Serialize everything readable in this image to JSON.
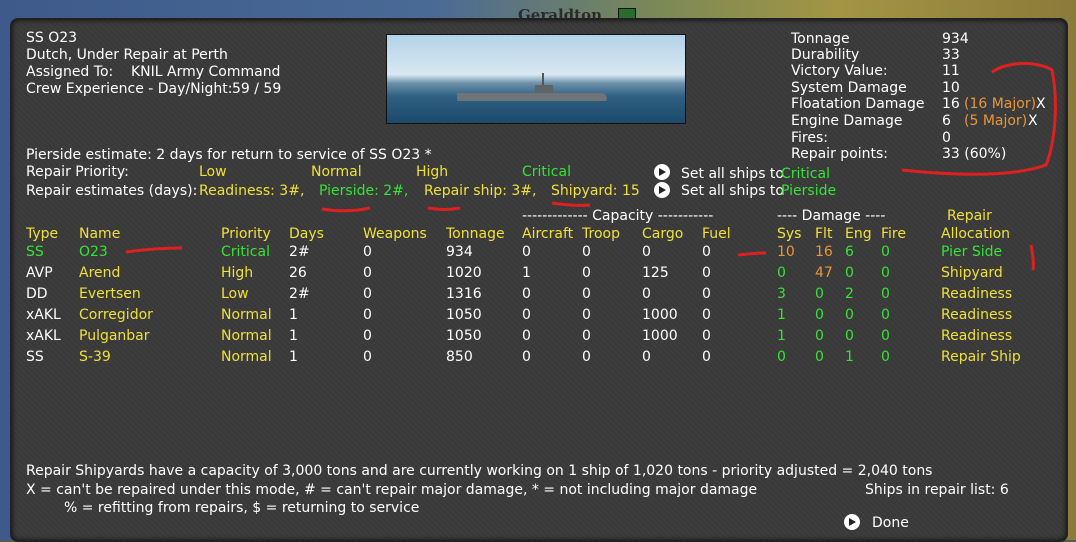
{
  "map": {
    "label": "Geraldton"
  },
  "ship": {
    "title": "SS O23",
    "status": "Dutch, Under Repair at Perth",
    "assigned_label": "Assigned To:",
    "assigned_value": "KNIL Army Command",
    "crew_label": "Crew Experience - Day/Night:",
    "crew_value": "59  /  59"
  },
  "stats": {
    "tonnage_label": "Tonnage",
    "tonnage": "934",
    "durability_label": "Durability",
    "durability": "33",
    "victory_label": "Victory Value:",
    "victory": "11",
    "system_label": "System Damage",
    "system": "10",
    "floatation_label": "Floatation Damage",
    "floatation": "16",
    "floatation_major": "(16 Major)",
    "engine_label": "Engine Damage",
    "engine": "6",
    "engine_major": "(5 Major)",
    "fires_label": "Fires:",
    "fires": "0",
    "repair_points_label": "Repair points:",
    "repair_points": "33 (60%)",
    "x_mark": "X"
  },
  "estimate": {
    "pierside_text": "Pierside estimate: 2 days for return to service of SS O23 *",
    "priority_label": "Repair Priority:",
    "priorities": [
      "Low",
      "Normal",
      "High",
      "Critical"
    ],
    "estimates_label": "Repair estimates (days):",
    "readiness": "Readiness: 3#,",
    "pierside": "Pierside: 2#,",
    "repair_ship": "Repair ship: 3#,",
    "shipyard": "Shipyard: 15",
    "set_all_critical_prefix": "Set all ships to",
    "set_all_critical_value": "Critical",
    "set_all_pierside_prefix": "Set all ships to",
    "set_all_pierside_value": "Pierside"
  },
  "table": {
    "capacity_header": "------------- Capacity -----------",
    "damage_header": "---- Damage ----",
    "repair_header": "Repair",
    "columns": [
      "Type",
      "Name",
      "Priority",
      "Days",
      "Weapons",
      "Tonnage",
      "Aircraft",
      "Troop",
      "Cargo",
      "Fuel",
      "Sys",
      "Flt",
      "Eng",
      "Fire",
      "Allocation"
    ],
    "rows": [
      {
        "type": "SS",
        "name": "O23",
        "priority": "Critical",
        "days": "2#",
        "weapons": "0",
        "tonnage": "934",
        "aircraft": "0",
        "troop": "0",
        "cargo": "0",
        "fuel": "0",
        "sys": "10",
        "flt": "16",
        "eng": "6",
        "fire": "0",
        "alloc": "Pier Side"
      },
      {
        "type": "AVP",
        "name": "Arend",
        "priority": "High",
        "days": "26",
        "weapons": "0",
        "tonnage": "1020",
        "aircraft": "1",
        "troop": "0",
        "cargo": "125",
        "fuel": "0",
        "sys": "0",
        "flt": "47",
        "eng": "0",
        "fire": "0",
        "alloc": "Shipyard"
      },
      {
        "type": "DD",
        "name": "Evertsen",
        "priority": "Low",
        "days": "2#",
        "weapons": "0",
        "tonnage": "1316",
        "aircraft": "0",
        "troop": "0",
        "cargo": "0",
        "fuel": "0",
        "sys": "3",
        "flt": "0",
        "eng": "2",
        "fire": "0",
        "alloc": "Readiness"
      },
      {
        "type": "xAKL",
        "name": "Corregidor",
        "priority": "Normal",
        "days": "1",
        "weapons": "0",
        "tonnage": "1050",
        "aircraft": "0",
        "troop": "0",
        "cargo": "1000",
        "fuel": "0",
        "sys": "1",
        "flt": "0",
        "eng": "0",
        "fire": "0",
        "alloc": "Readiness"
      },
      {
        "type": "xAKL",
        "name": "Pulganbar",
        "priority": "Normal",
        "days": "1",
        "weapons": "0",
        "tonnage": "1050",
        "aircraft": "0",
        "troop": "0",
        "cargo": "1000",
        "fuel": "0",
        "sys": "1",
        "flt": "0",
        "eng": "0",
        "fire": "0",
        "alloc": "Readiness"
      },
      {
        "type": "SS",
        "name": "S-39",
        "priority": "Normal",
        "days": "1",
        "weapons": "0",
        "tonnage": "850",
        "aircraft": "0",
        "troop": "0",
        "cargo": "0",
        "fuel": "0",
        "sys": "0",
        "flt": "0",
        "eng": "1",
        "fire": "0",
        "alloc": "Repair Ship"
      }
    ]
  },
  "footer": {
    "capacity_note": "Repair Shipyards have a capacity of 3,000 tons and are currently working on 1 ship of 1,020 tons - priority adjusted = 2,040 tons",
    "legend1": "X = can't be repaired under this mode, # = can't repair major damage, * = not including major damage",
    "legend2": "% = refitting from repairs, $ = returning to service",
    "ships_in_list": "Ships in repair list: 6",
    "done": "Done"
  },
  "colors": {
    "white": "#ffffff",
    "yellow": "#f0e03a",
    "green": "#36e336",
    "orange": "#e8963a",
    "panel": "#3a3a3a"
  }
}
